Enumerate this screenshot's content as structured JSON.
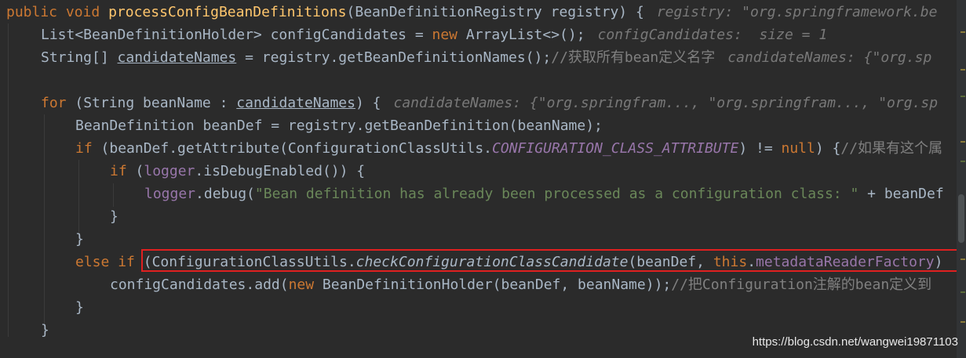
{
  "code": {
    "l1": {
      "kw_public": "public",
      "kw_void": "void",
      "method": "processConfigBeanDefinitions",
      "params": "(BeanDefinitionRegistry registry) {",
      "hint": "registry: \"org.springframework.be"
    },
    "l2": {
      "a": "List<BeanDefinitionHolder> configCandidates = ",
      "kw_new": "new",
      "b": " ArrayList<>();",
      "hint": "configCandidates:  size = 1"
    },
    "l3": {
      "a": "String[] ",
      "var": "candidateNames",
      "b": " = registry.getBeanDefinitionNames();",
      "comment": "//获取所有bean定义名字",
      "hint": "candidateNames: {\"org.sp"
    },
    "l5": {
      "kw_for": "for",
      "a": " (String beanName : ",
      "var": "candidateNames",
      "b": ") {",
      "hint": "candidateNames: {\"org.springfram..., \"org.springfram..., \"org.sp"
    },
    "l6": {
      "a": "BeanDefinition beanDef = registry.getBeanDefinition(beanName);"
    },
    "l7": {
      "kw_if": "if",
      "a": " (beanDef.getAttribute(ConfigurationClassUtils.",
      "const": "CONFIGURATION_CLASS_ATTRIBUTE",
      "b": ") != ",
      "kw_null": "null",
      "c": ") {",
      "comment": "//如果有这个属"
    },
    "l8": {
      "kw_if": "if",
      "a": " (",
      "field": "logger",
      "b": ".isDebugEnabled()) {"
    },
    "l9": {
      "field": "logger",
      "a": ".debug(",
      "str": "\"Bean definition has already been processed as a configuration class: \"",
      "b": " + beanDef"
    },
    "l10": {
      "a": "}"
    },
    "l11": {
      "a": "}"
    },
    "l12": {
      "kw_else": "else",
      "kw_if": "if",
      "a": "(ConfigurationClassUtils.",
      "smethod": "checkConfigurationClassCandidate",
      "b": "(beanDef, ",
      "kw_this": "this",
      "c": ".",
      "field": "metadataReaderFactory",
      "d": ")"
    },
    "l13": {
      "a": "configCandidates.add(",
      "kw_new": "new",
      "b": " BeanDefinitionHolder(beanDef, beanName));",
      "comment": "//把Configuration注解的bean定义到"
    },
    "l14": {
      "a": "}"
    },
    "l15": {
      "a": "}"
    }
  },
  "watermark": "https://blog.csdn.net/wangwei19871103",
  "colors": {
    "background": "#2b2b2b",
    "keyword": "#cc7832",
    "method": "#ffc66d",
    "string": "#6a8759",
    "field": "#9876aa",
    "comment": "#808080",
    "text": "#a9b7c6",
    "highlight_box": "#e02020"
  }
}
